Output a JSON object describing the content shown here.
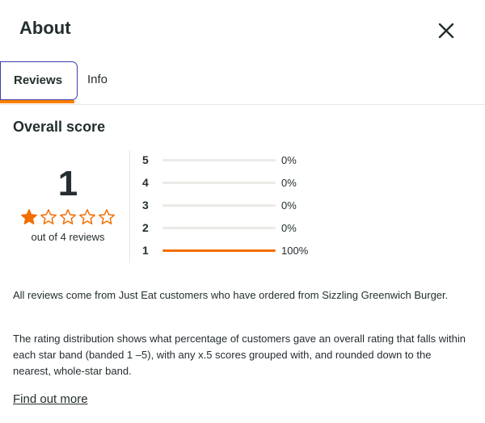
{
  "dialog": {
    "title": "About",
    "close_icon": "close-icon"
  },
  "tabs": [
    {
      "label": "Reviews",
      "active": true
    },
    {
      "label": "Info",
      "active": false
    }
  ],
  "overall": {
    "heading": "Overall score",
    "score": "1",
    "rating": 1,
    "max_rating": 5,
    "out_of": "out of 4 reviews",
    "star_color": "#f36d00"
  },
  "distribution": [
    {
      "star": "5",
      "pct": "0%",
      "value": 0
    },
    {
      "star": "4",
      "pct": "0%",
      "value": 0
    },
    {
      "star": "3",
      "pct": "0%",
      "value": 0
    },
    {
      "star": "2",
      "pct": "0%",
      "value": 0
    },
    {
      "star": "1",
      "pct": "100%",
      "value": 100
    }
  ],
  "info": {
    "p1": "All reviews come from Just Eat customers who have ordered from Sizzling Greenwich Burger.",
    "p2": "The rating distribution shows what percentage of customers gave an overall rating that falls within each star band (banded 1 –5), with any x.5 scores grouped with, and rounded down to the nearest, whole-star band.",
    "link": "Find out more"
  },
  "colors": {
    "accent": "#ff8000",
    "bar_fill": "#f36d00",
    "tab_focus": "#3e3ea8"
  }
}
